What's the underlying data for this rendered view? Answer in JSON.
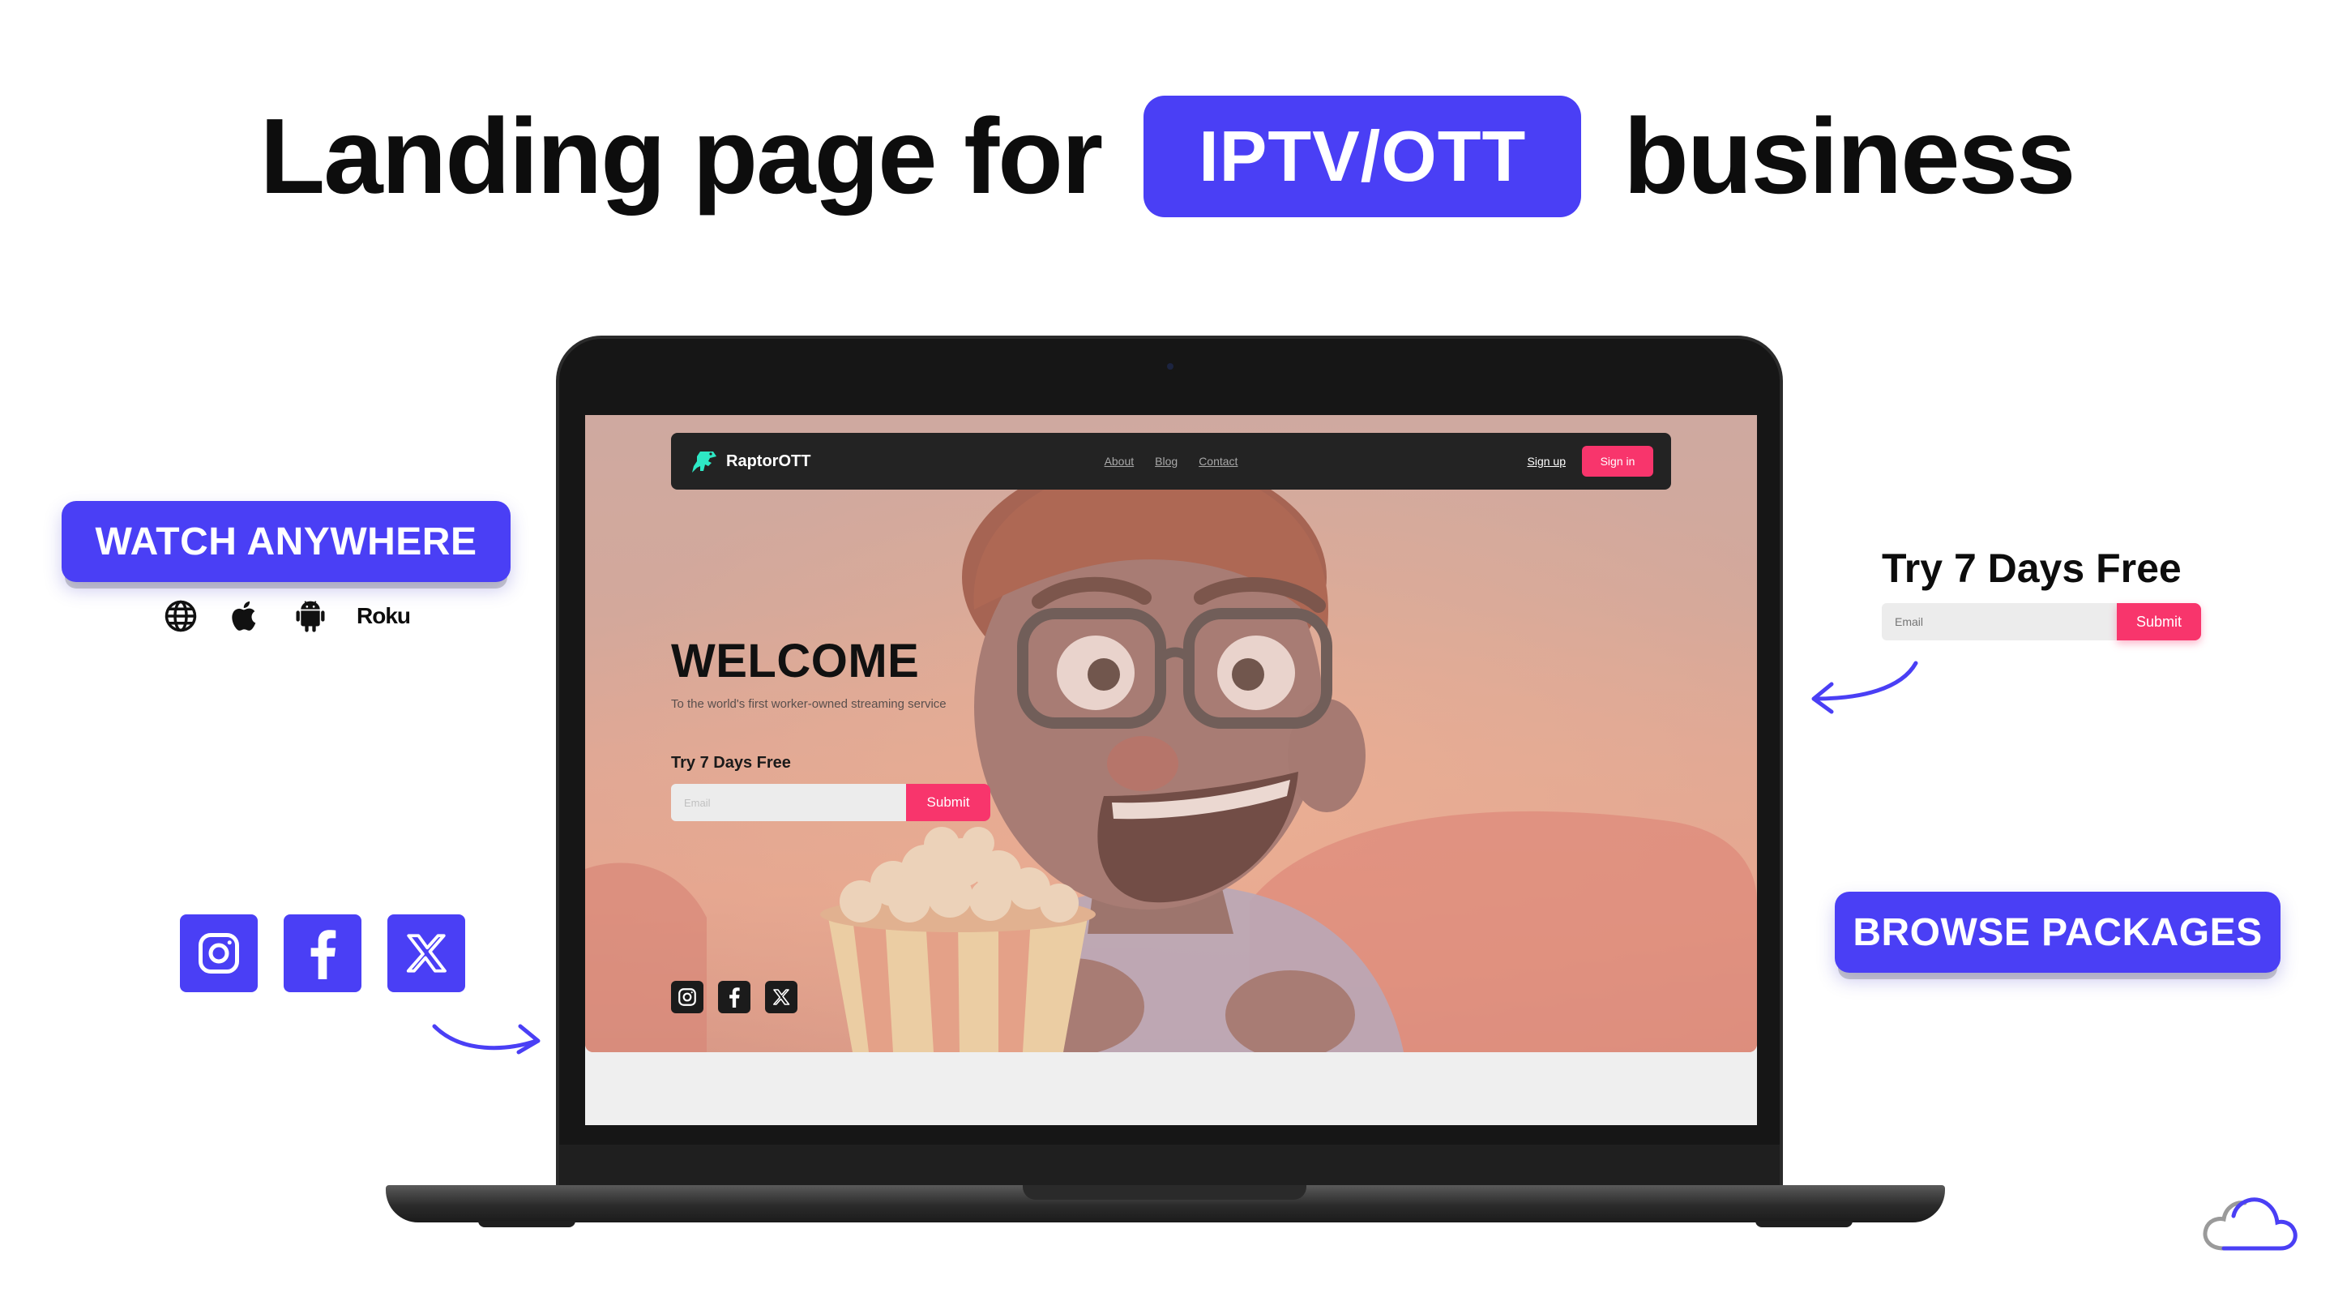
{
  "headline": {
    "before": "Landing page for",
    "badge": "IPTV/OTT",
    "after": "business"
  },
  "callouts": {
    "watch_anywhere": "WATCH ANYWHERE",
    "platforms": [
      "globe-icon",
      "apple-icon",
      "android-icon",
      "Roku"
    ],
    "roku_label": "Roku",
    "browse_packages": "BROWSE PACKAGES",
    "try_free_title": "Try 7 Days Free",
    "email_placeholder": "Email",
    "submit_label": "Submit",
    "social_icons": [
      "instagram-icon",
      "facebook-icon",
      "x-icon"
    ]
  },
  "site": {
    "brand": "RaptorOTT",
    "nav_links": [
      "About",
      "Blog",
      "Contact"
    ],
    "signup": "Sign up",
    "signin": "Sign in",
    "welcome": "WELCOME",
    "subtitle": "To the world's first worker-owned streaming service",
    "try_free_title": "Try 7 Days Free",
    "email_placeholder": "Email",
    "submit_label": "Submit",
    "social_icons": [
      "instagram-icon",
      "facebook-icon",
      "x-icon"
    ]
  },
  "colors": {
    "accent": "#4a3ff5",
    "cta": "#f8356c",
    "nav_bg": "#232323"
  }
}
